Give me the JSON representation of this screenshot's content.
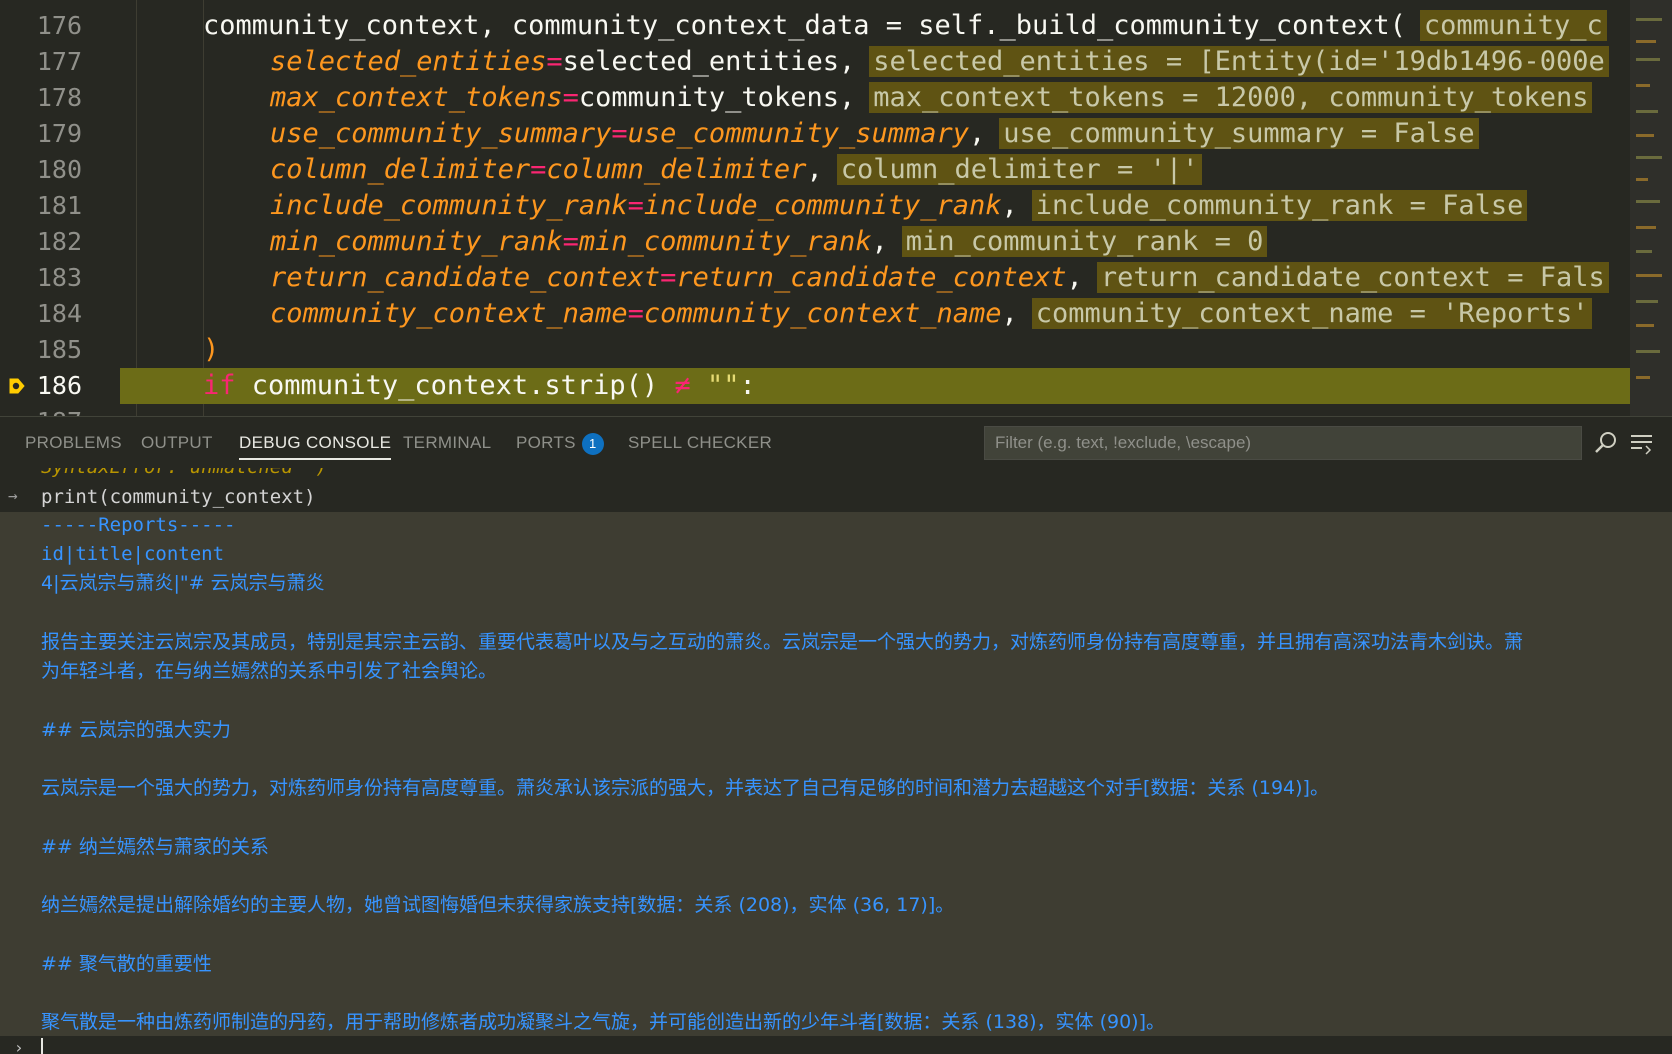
{
  "editor": {
    "lines": [
      {
        "num": "176",
        "text": "community_context, community_context_data = self._build_community_context(",
        "hint": "community_c"
      },
      {
        "num": "177",
        "param": "selected_entities",
        "arg": "selected_entities",
        "hint": "selected_entities = [Entity(id='19db1496-000e"
      },
      {
        "num": "178",
        "param": "max_context_tokens",
        "arg": "community_tokens",
        "hint": "max_context_tokens = 12000, community_tokens"
      },
      {
        "num": "179",
        "param": "use_community_summary",
        "arg": "use_community_summary",
        "hint": "use_community_summary = False"
      },
      {
        "num": "180",
        "param": "column_delimiter",
        "arg": "column_delimiter",
        "hint": "column_delimiter = '|'"
      },
      {
        "num": "181",
        "param": "include_community_rank",
        "arg": "include_community_rank",
        "hint": "include_community_rank = False"
      },
      {
        "num": "182",
        "param": "min_community_rank",
        "arg": "min_community_rank",
        "hint": "min_community_rank = 0"
      },
      {
        "num": "183",
        "param": "return_candidate_context",
        "arg": "return_candidate_context",
        "hint": "return_candidate_context = Fals"
      },
      {
        "num": "184",
        "param": "community_context_name",
        "arg": "community_context_name",
        "hint": "community_context_name = 'Reports'"
      },
      {
        "num": "185",
        "text": ")"
      },
      {
        "num": "186",
        "kw": "if",
        "text": "community_context.strip()",
        "op": "≠",
        "str": "\"\"",
        "tail": ":"
      }
    ]
  },
  "panel": {
    "tabs": [
      {
        "label": "PROBLEMS",
        "active": false
      },
      {
        "label": "OUTPUT",
        "active": false
      },
      {
        "label": "DEBUG CONSOLE",
        "active": true
      },
      {
        "label": "TERMINAL",
        "active": false
      },
      {
        "label": "PORTS",
        "active": false,
        "badge": "1"
      },
      {
        "label": "SPELL CHECKER",
        "active": false
      }
    ],
    "filter_placeholder": "Filter (e.g. text, !exclude, \\escape)"
  },
  "console": {
    "cut_text": "SyntaxError: unmatched ')'",
    "input": "print(community_context)",
    "output": [
      "-----Reports-----",
      "id|title|content",
      "4|云岚宗与萧炎|\"# 云岚宗与萧炎",
      "",
      "报告主要关注云岚宗及其成员，特别是其宗主云韵、重要代表葛叶以及与之互动的萧炎。云岚宗是一个强大的势力，对炼药师身份持有高度尊重，并且拥有高深功法青木剑诀。萧",
      "为年轻斗者，在与纳兰嫣然的关系中引发了社会舆论。",
      "",
      "## 云岚宗的强大实力",
      "",
      "云岚宗是一个强大的势力，对炼药师身份持有高度尊重。萧炎承认该宗派的强大，并表达了自己有足够的时间和潜力去超越这个对手[数据：关系 (194)]。",
      "",
      "## 纳兰嫣然与萧家的关系",
      "",
      "纳兰嫣然是提出解除婚约的主要人物，她曾试图悔婚但未获得家族支持[数据：关系 (208)，实体 (36, 17)]。",
      "",
      "## 聚气散的重要性",
      "",
      "聚气散是一种由炼药师制造的丹药，用于帮助修炼者成功凝聚斗之气旋，并可能创造出新的少年斗者[数据：关系 (138)，实体 (90)]。"
    ],
    "prompt": "›"
  }
}
